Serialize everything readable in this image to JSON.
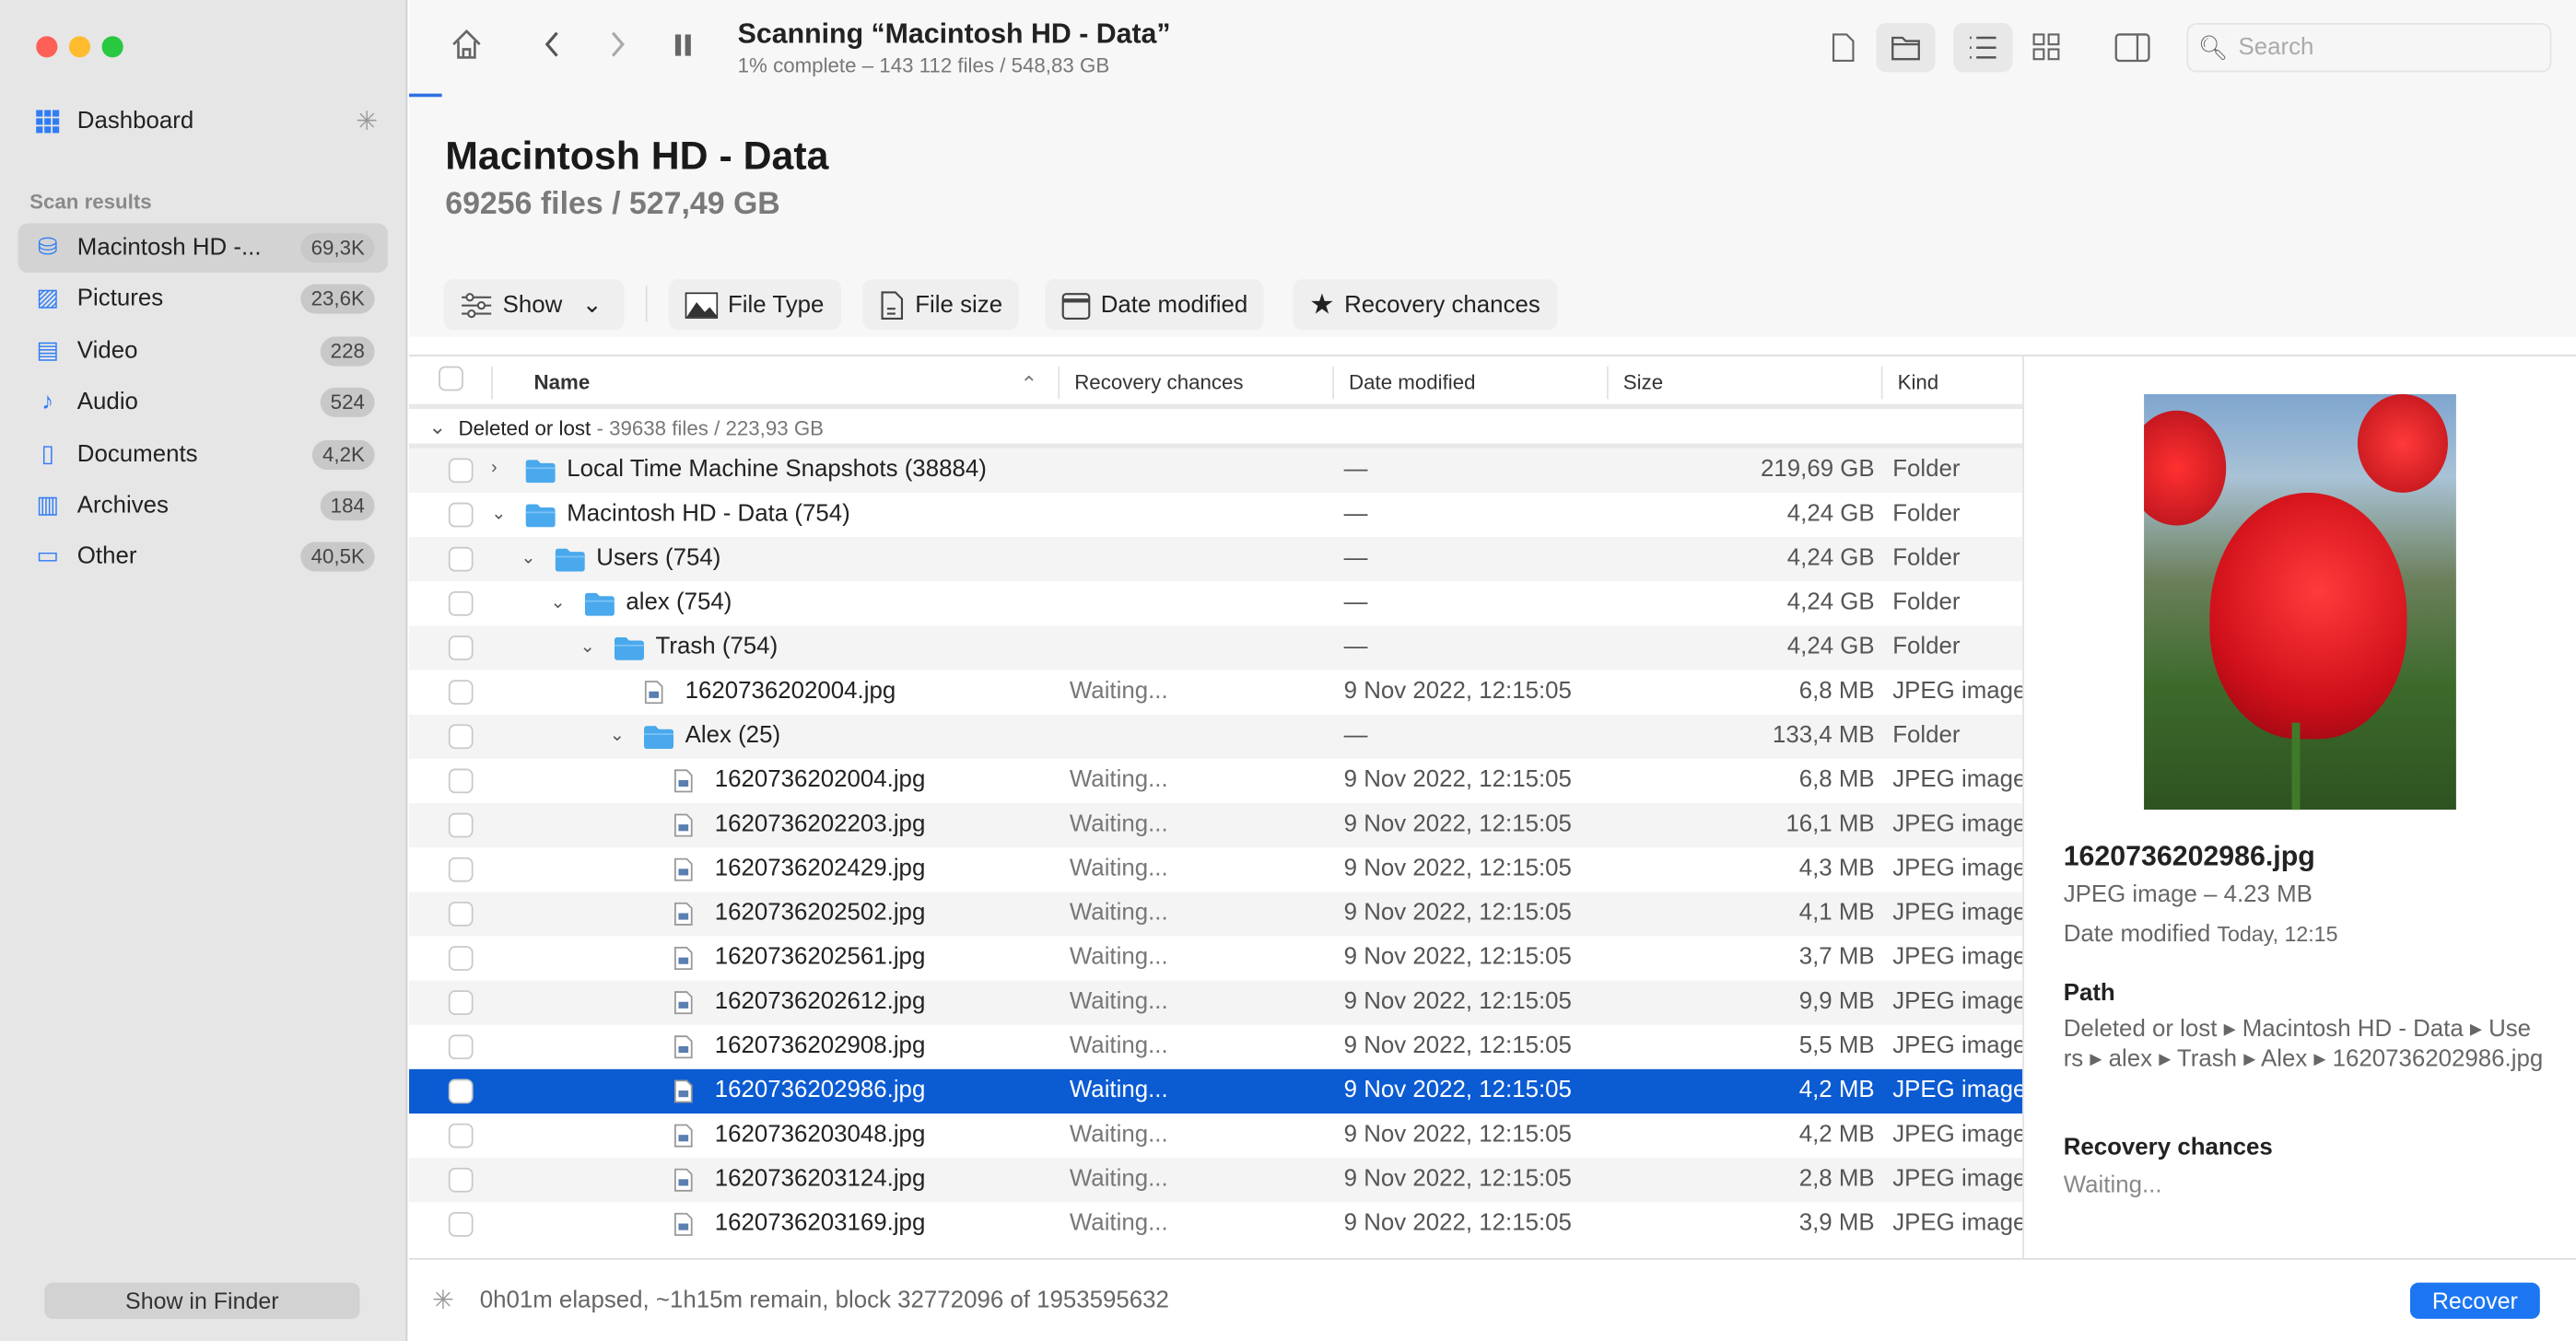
{
  "sidebar": {
    "dashboard": "Dashboard",
    "section": "Scan results",
    "items": [
      {
        "label": "Macintosh HD -...",
        "count": "69,3K",
        "icon": "drive-icon"
      },
      {
        "label": "Pictures",
        "count": "23,6K",
        "icon": "pictures-icon"
      },
      {
        "label": "Video",
        "count": "228",
        "icon": "video-icon"
      },
      {
        "label": "Audio",
        "count": "524",
        "icon": "audio-icon"
      },
      {
        "label": "Documents",
        "count": "4,2K",
        "icon": "document-icon"
      },
      {
        "label": "Archives",
        "count": "184",
        "icon": "archive-icon"
      },
      {
        "label": "Other",
        "count": "40,5K",
        "icon": "other-icon"
      }
    ],
    "show_in_finder": "Show in Finder"
  },
  "toolbar": {
    "title": "Scanning “Macintosh HD - Data”",
    "subtitle": "1% complete – 143 112 files / 548,83 GB",
    "progress_percent": 1,
    "search_placeholder": "Search"
  },
  "header": {
    "title": "Macintosh HD - Data",
    "subtitle": "69256 files / 527,49 GB"
  },
  "filters": {
    "show": "Show",
    "file_type": "File Type",
    "file_size": "File size",
    "date_modified": "Date modified",
    "recovery_chances": "Recovery chances"
  },
  "table": {
    "columns": [
      "Name",
      "Recovery chances",
      "Date modified",
      "Size",
      "Kind"
    ],
    "group": {
      "label": "Deleted or lost",
      "info": " - 39638 files / 223,93 GB"
    },
    "rows": [
      {
        "name": "Local Time Machine Snapshots (38884)",
        "rc": "",
        "date": "—",
        "size": "219,69 GB",
        "kind": "Folder",
        "folder": true,
        "level": 0,
        "chev": "›"
      },
      {
        "name": "Macintosh HD - Data (754)",
        "rc": "",
        "date": "—",
        "size": "4,24 GB",
        "kind": "Folder",
        "folder": true,
        "level": 0,
        "chev": "⌄"
      },
      {
        "name": "Users (754)",
        "rc": "",
        "date": "—",
        "size": "4,24 GB",
        "kind": "Folder",
        "folder": true,
        "level": 1,
        "chev": "⌄"
      },
      {
        "name": "alex (754)",
        "rc": "",
        "date": "—",
        "size": "4,24 GB",
        "kind": "Folder",
        "folder": true,
        "level": 2,
        "chev": "⌄"
      },
      {
        "name": "Trash (754)",
        "rc": "",
        "date": "—",
        "size": "4,24 GB",
        "kind": "Folder",
        "folder": true,
        "level": 3,
        "chev": "⌄"
      },
      {
        "name": "1620736202004.jpg",
        "rc": "Waiting...",
        "date": "9 Nov 2022, 12:15:05",
        "size": "6,8 MB",
        "kind": "JPEG image",
        "level": 4
      },
      {
        "name": "Alex (25)",
        "rc": "",
        "date": "—",
        "size": "133,4 MB",
        "kind": "Folder",
        "folder": true,
        "level": 4,
        "chev": "⌄"
      },
      {
        "name": "1620736202004.jpg",
        "rc": "Waiting...",
        "date": "9 Nov 2022, 12:15:05",
        "size": "6,8 MB",
        "kind": "JPEG image",
        "level": 5
      },
      {
        "name": "1620736202203.jpg",
        "rc": "Waiting...",
        "date": "9 Nov 2022, 12:15:05",
        "size": "16,1 MB",
        "kind": "JPEG image",
        "level": 5
      },
      {
        "name": "1620736202429.jpg",
        "rc": "Waiting...",
        "date": "9 Nov 2022, 12:15:05",
        "size": "4,3 MB",
        "kind": "JPEG image",
        "level": 5
      },
      {
        "name": "1620736202502.jpg",
        "rc": "Waiting...",
        "date": "9 Nov 2022, 12:15:05",
        "size": "4,1 MB",
        "kind": "JPEG image",
        "level": 5
      },
      {
        "name": "1620736202561.jpg",
        "rc": "Waiting...",
        "date": "9 Nov 2022, 12:15:05",
        "size": "3,7 MB",
        "kind": "JPEG image",
        "level": 5
      },
      {
        "name": "1620736202612.jpg",
        "rc": "Waiting...",
        "date": "9 Nov 2022, 12:15:05",
        "size": "9,9 MB",
        "kind": "JPEG image",
        "level": 5
      },
      {
        "name": "1620736202908.jpg",
        "rc": "Waiting...",
        "date": "9 Nov 2022, 12:15:05",
        "size": "5,5 MB",
        "kind": "JPEG image",
        "level": 5
      },
      {
        "name": "1620736202986.jpg",
        "rc": "Waiting...",
        "date": "9 Nov 2022, 12:15:05",
        "size": "4,2 MB",
        "kind": "JPEG image",
        "level": 5,
        "selected": true
      },
      {
        "name": "1620736203048.jpg",
        "rc": "Waiting...",
        "date": "9 Nov 2022, 12:15:05",
        "size": "4,2 MB",
        "kind": "JPEG image",
        "level": 5
      },
      {
        "name": "1620736203124.jpg",
        "rc": "Waiting...",
        "date": "9 Nov 2022, 12:15:05",
        "size": "2,8 MB",
        "kind": "JPEG image",
        "level": 5
      },
      {
        "name": "1620736203169.jpg",
        "rc": "Waiting...",
        "date": "9 Nov 2022, 12:15:05",
        "size": "3,9 MB",
        "kind": "JPEG image",
        "level": 5
      }
    ]
  },
  "detail": {
    "filename": "1620736202986.jpg",
    "type": "JPEG image – 4.23 MB",
    "date_label": "Date modified",
    "date_value": "Today, 12:15",
    "path_label": "Path",
    "path_line1": "Deleted or lost ▸ Macintosh HD - Data ▸ Use",
    "path_line2": "rs ▸ alex ▸ Trash ▸ Alex ▸ 1620736202986.jpg",
    "rc_label": "Recovery chances",
    "rc_value": "Waiting..."
  },
  "footer": {
    "status": "0h01m elapsed, ~1h15m remain, block 32772096 of 1953595632",
    "recover": "Recover"
  },
  "colors": {
    "accent": "#0b5bd3",
    "button": "#1c76f2",
    "folder": "#4aa8ec"
  }
}
